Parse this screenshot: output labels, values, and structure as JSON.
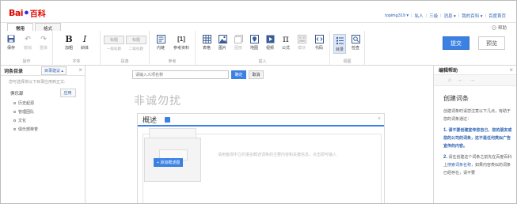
{
  "header": {
    "logo_bai": "Bai",
    "logo_du": "●",
    "logo_baike": "百科",
    "links": [
      "topimg319 ▾",
      "私人",
      "三级",
      "消息 ▾",
      "我的百科 ▾",
      "百度首页"
    ]
  },
  "tabs": [
    {
      "label": "常用",
      "active": true
    },
    {
      "label": "格式",
      "active": false
    }
  ],
  "help_label": "帮助",
  "ribbon": {
    "groups": [
      {
        "label": "操作"
      },
      {
        "label": "字体"
      },
      {
        "label": "段落"
      },
      {
        "label": "参考"
      },
      {
        "label": "插入"
      },
      {
        "label": "视图"
      }
    ],
    "buttons": {
      "save": "保存",
      "undo": "撤销",
      "redo": "重做",
      "bold": "加粗",
      "italic": "斜体",
      "title1": "标题",
      "title1_sub": "一级标题",
      "title2": "标题",
      "title2_sub": "二级标题",
      "innerlink": "内链",
      "reference": "参考资料",
      "table": "表格",
      "image": "图片",
      "album": "图册",
      "map": "地图",
      "video": "视频",
      "formula": "公式",
      "module": "模块",
      "code": "代码",
      "toc": "目录",
      "check": "检查"
    },
    "submit": "提交",
    "preview": "预览"
  },
  "left_panel": {
    "title": "词条目录",
    "suggest": "目录建议 ▴",
    "hint": "您可选择将以下目录应用到正文:",
    "section": "俱乐部",
    "apply": "应用",
    "items": [
      "历史起源",
      "管理团队",
      "文化",
      "俱乐部荣誉"
    ]
  },
  "editor": {
    "name_placeholder": "请输入义项名称",
    "confirm": "确定",
    "cancel": "取消",
    "entry_title": "非诚勿扰",
    "abstract_title": "概述",
    "abstract_placeholder": "请用客观中立的语言概述词条的主要内容和关键信息，点击即可输入",
    "add_pic": "+ 添加概述图"
  },
  "right_panel": {
    "title": "编辑帮助",
    "heading": "创建词条",
    "intro": "创建词条时请您注意以下几点，有助于您的词条通过：",
    "step1_num": "1.",
    "step1_text": "请不要创建宣传您自己、您的朋友或您的公司的词条，这不是任何类似广告宣传的内容。",
    "step2_num": "2.",
    "step2_a": "请在创建这个词条之前先在百度百科上",
    "step2_link": "搜索词条名称",
    "step2_b": "，如果内容类似的词条已经存在，请不要"
  },
  "colors": {
    "accent": "#3b81e4",
    "link": "#2d64b3",
    "brand_red": "#e10601"
  }
}
